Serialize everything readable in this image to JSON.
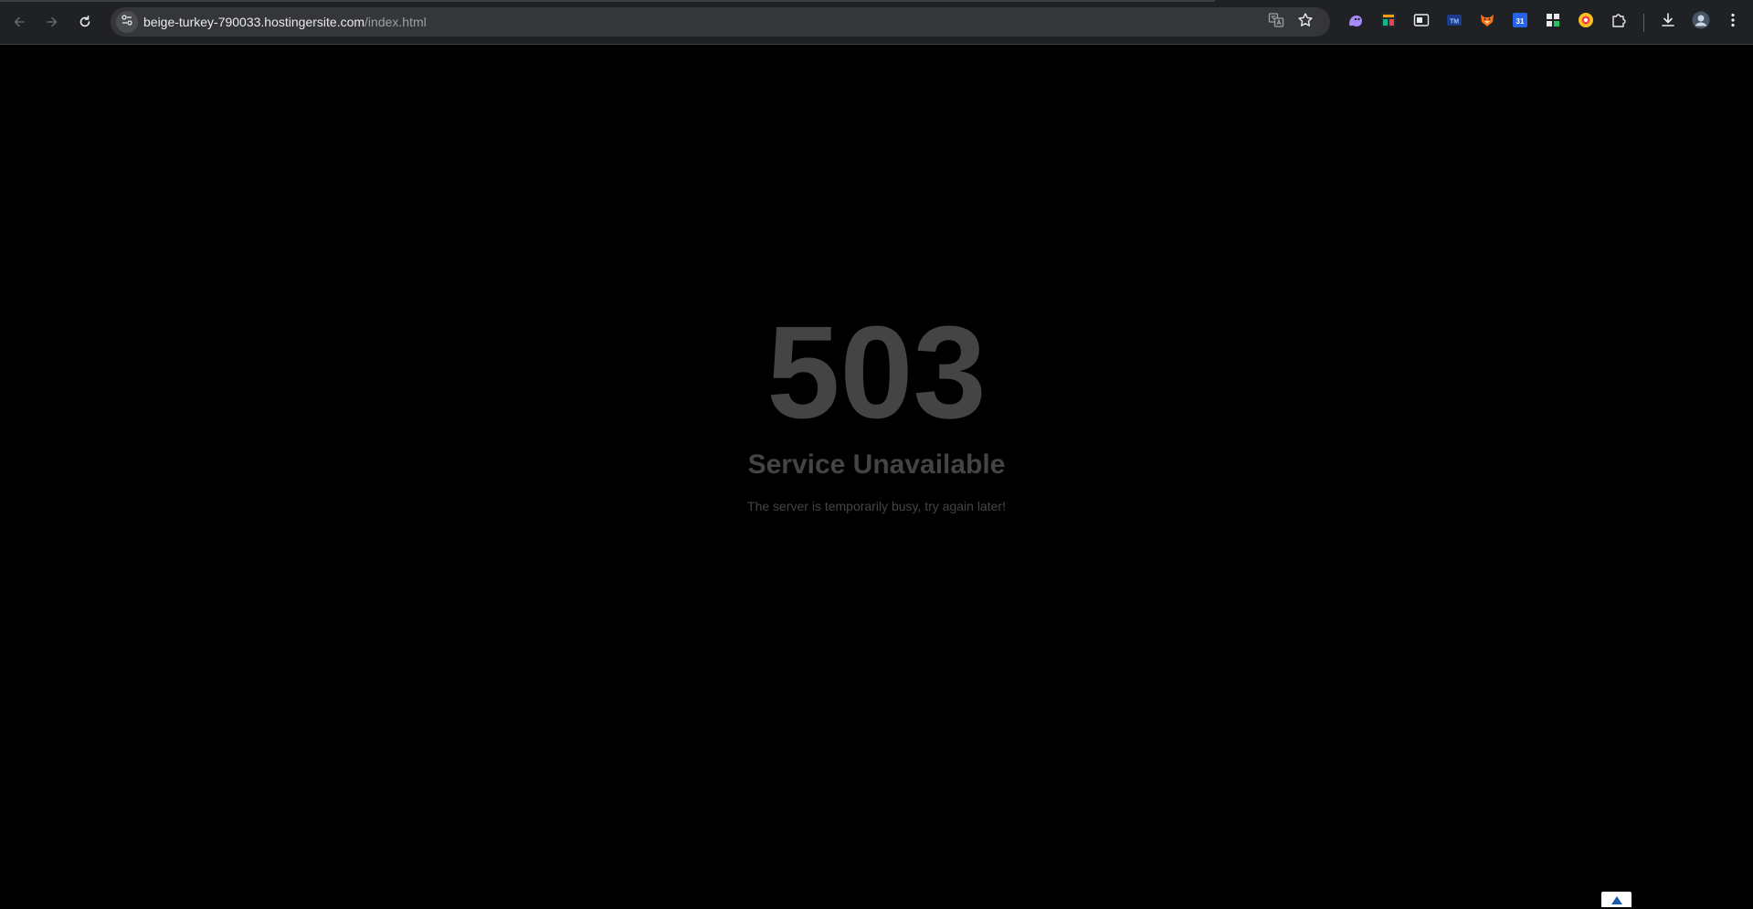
{
  "browser": {
    "url_host": "beige-turkey-790033.hostingersite.com",
    "url_path": "/index.html",
    "extensions": [
      {
        "name": "ghost-extension-icon",
        "color": "#a78bfa"
      },
      {
        "name": "chart-extension-icon",
        "color": "#f59e0b"
      },
      {
        "name": "window-extension-icon",
        "color": "#e8eaed"
      },
      {
        "name": "tm-extension-icon",
        "color": "#3b82f6"
      },
      {
        "name": "fox-extension-icon",
        "color": "#f97316"
      },
      {
        "name": "calendar-extension-icon",
        "color": "#2563eb"
      },
      {
        "name": "grid-extension-icon",
        "color": "#e8eaed"
      },
      {
        "name": "circle-extension-icon",
        "color": "#fbbf24"
      },
      {
        "name": "puzzle-extensions-icon",
        "color": "#e8eaed"
      }
    ]
  },
  "page": {
    "error_code": "503",
    "error_title": "Service Unavailable",
    "error_message": "The server is temporarily busy, try again later!"
  },
  "colors": {
    "page_background": "#000000",
    "error_text": "#444444",
    "chrome_bar": "#202124",
    "omnibox": "#35363a",
    "scroll_top_arrow": "#1e5aa8"
  }
}
